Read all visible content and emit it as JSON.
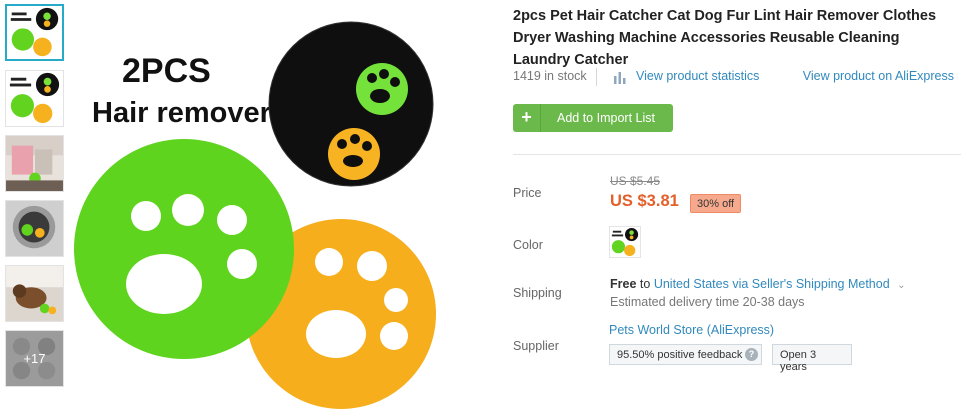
{
  "thumbnails": {
    "more_label": "+17"
  },
  "main_image": {
    "overlay_line1": "2PCS",
    "overlay_line2": "Hair remover"
  },
  "product": {
    "title": "2pcs Pet Hair Catcher Cat Dog Fur Lint Hair Remover Clothes Dryer Washing Machine Accessories Reusable Cleaning Laundry Catcher",
    "stock": "1419 in stock",
    "stats_link": "View product statistics",
    "aliexpress_link": "View product on AliExpress",
    "add_button": "Add to Import List",
    "add_icon": "+"
  },
  "price": {
    "label": "Price",
    "original": "US $5.45",
    "current": "US $3.81",
    "discount": "30% off"
  },
  "color": {
    "label": "Color"
  },
  "shipping": {
    "label": "Shipping",
    "free": "Free",
    "to": "to",
    "method": "United States via Seller's Shipping Method",
    "estimate": "Estimated delivery time 20-38 days"
  },
  "supplier": {
    "label": "Supplier",
    "name": "Pets World Store (AliExpress)",
    "feedback": "95.50% positive feedback",
    "open": "Open 3 years",
    "help_icon": "?"
  },
  "colors": {
    "accent": "#3189bd",
    "button": "#6cb94b",
    "price": "#e4602b",
    "thumb_active": "#27a9c8"
  }
}
